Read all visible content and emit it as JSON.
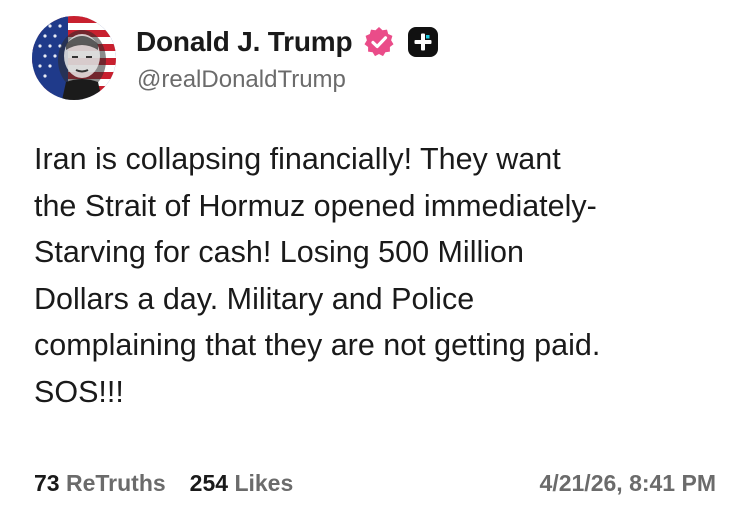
{
  "author": {
    "display_name": "Donald J. Trump",
    "handle": "@realDonaldTrump",
    "verified_icon": "verified-badge-icon",
    "plus_icon": "plus-badge-icon",
    "verified_color": "#ea4c89"
  },
  "post": {
    "text": "Iran is collapsing financially! They want\nthe Strait of Hormuz opened immediately-\nStarving for cash! Losing 500 Million\nDollars a day. Military and Police\ncomplaining that they are not getting paid.\nSOS!!!"
  },
  "stats": {
    "retruths_count": "73",
    "retruths_label": "ReTruths",
    "likes_count": "254",
    "likes_label": "Likes",
    "timestamp": "4/21/26, 8:41 PM"
  }
}
